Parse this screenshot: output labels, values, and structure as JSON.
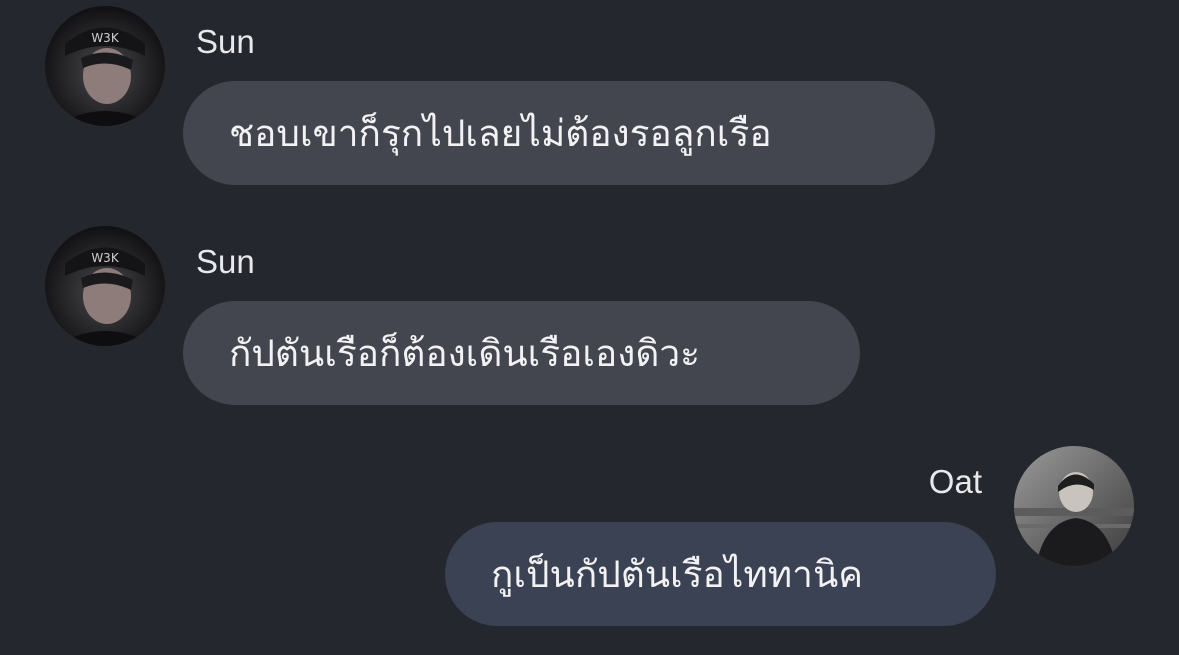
{
  "colors": {
    "background": "#25272e",
    "incoming_bubble": "#44464f",
    "outgoing_bubble": "#3a4253",
    "text": "#f2f2f4"
  },
  "messages": [
    {
      "sender": "Sun",
      "direction": "incoming",
      "avatar_icon": "user-avatar-photo",
      "text": "ชอบเขาก็รุกไปเลยไม่ต้องรอลูกเรือ"
    },
    {
      "sender": "Sun",
      "direction": "incoming",
      "avatar_icon": "user-avatar-photo",
      "text": "กัปตันเรือก็ต้องเดินเรือเองดิวะ"
    },
    {
      "sender": "Oat",
      "direction": "outgoing",
      "avatar_icon": "user-avatar-photo",
      "text": "กูเป็นกัปตันเรือไททานิค"
    }
  ]
}
